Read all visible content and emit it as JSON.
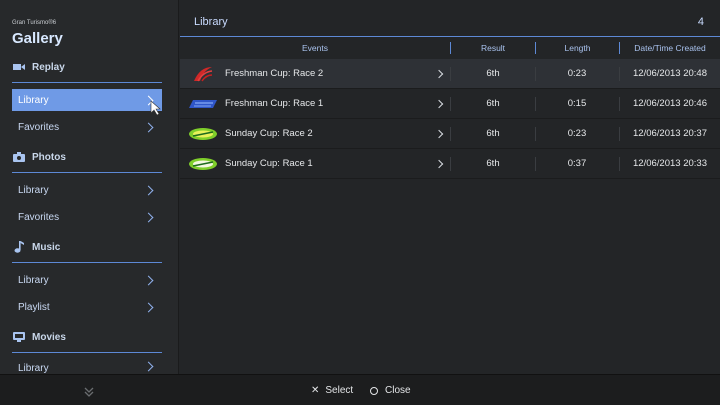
{
  "app": {
    "small_title": "Gran Turismo®6",
    "title": "Gallery"
  },
  "sidebar": {
    "sections": [
      {
        "label": "Replay",
        "icon": "video-camera-icon"
      },
      {
        "label": "Photos",
        "icon": "camera-icon"
      },
      {
        "label": "Music",
        "icon": "music-note-icon"
      },
      {
        "label": "Movies",
        "icon": "monitor-icon"
      }
    ],
    "replay_items": [
      "Library",
      "Favorites"
    ],
    "photos_items": [
      "Library",
      "Favorites"
    ],
    "music_items": [
      "Library",
      "Playlist"
    ],
    "movies_items": [
      "Library"
    ],
    "selected": "replay_library"
  },
  "main": {
    "title": "Library",
    "count": "4",
    "columns": [
      "Events",
      "Result",
      "Length",
      "Date/Time Created"
    ],
    "rows": [
      {
        "logo": "red-wing-logo",
        "event": "Freshman Cup: Race 2",
        "result": "6th",
        "length": "0:23",
        "date": "12/06/2013 20:48"
      },
      {
        "logo": "blue-racing-logo",
        "event": "Freshman Cup: Race 1",
        "result": "6th",
        "length": "0:15",
        "date": "12/06/2013 20:46"
      },
      {
        "logo": "green-sunday-cup-logo",
        "event": "Sunday Cup: Race 2",
        "result": "6th",
        "length": "0:23",
        "date": "12/06/2013 20:37"
      },
      {
        "logo": "green-sunday-cup-logo",
        "event": "Sunday Cup: Race 1",
        "result": "6th",
        "length": "0:37",
        "date": "12/06/2013 20:33"
      }
    ]
  },
  "footer": {
    "select_label": "Select",
    "close_label": "Close",
    "select_icon": "cross-icon",
    "close_icon": "circle-icon"
  },
  "colors": {
    "accent": "#6f9ae6",
    "divider": "#5d89d6",
    "background": "#232527"
  }
}
